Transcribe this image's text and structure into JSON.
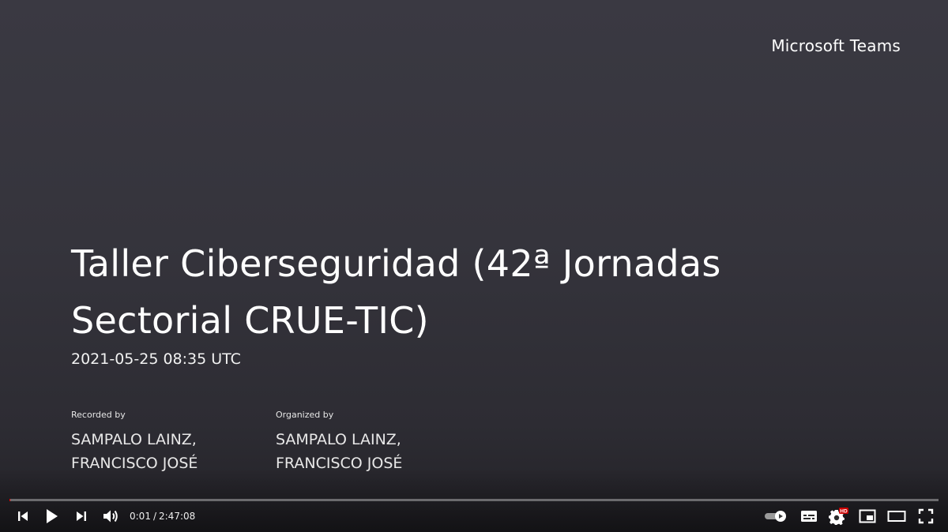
{
  "slide": {
    "brand": "Microsoft Teams",
    "title": "Taller Ciberseguridad (42ª Jornadas Sectorial CRUE-TIC)",
    "datetime": "2021-05-25 08:35 UTC",
    "recorded_by": {
      "label": "Recorded by",
      "name_line1": "SAMPALO LAINZ,",
      "name_line2": "FRANCISCO JOSÉ"
    },
    "organized_by": {
      "label": "Organized by",
      "name_line1": "SAMPALO LAINZ,",
      "name_line2": "FRANCISCO JOSÉ"
    }
  },
  "player": {
    "current_time": "0:01",
    "separator": "/",
    "duration": "2:47:08",
    "progress_fraction": 0.0001,
    "controls_left": [
      "previous-icon",
      "play-icon",
      "next-icon",
      "volume-icon"
    ],
    "controls_right": [
      "autoplay-toggle-icon",
      "subtitles-icon",
      "settings-icon",
      "miniplayer-icon",
      "theater-mode-icon",
      "fullscreen-icon"
    ],
    "settings_badge": "HD",
    "colors": {
      "progress": "#ff0000",
      "hd_badge": "#cc0000",
      "slide_background": "#36353d"
    }
  }
}
